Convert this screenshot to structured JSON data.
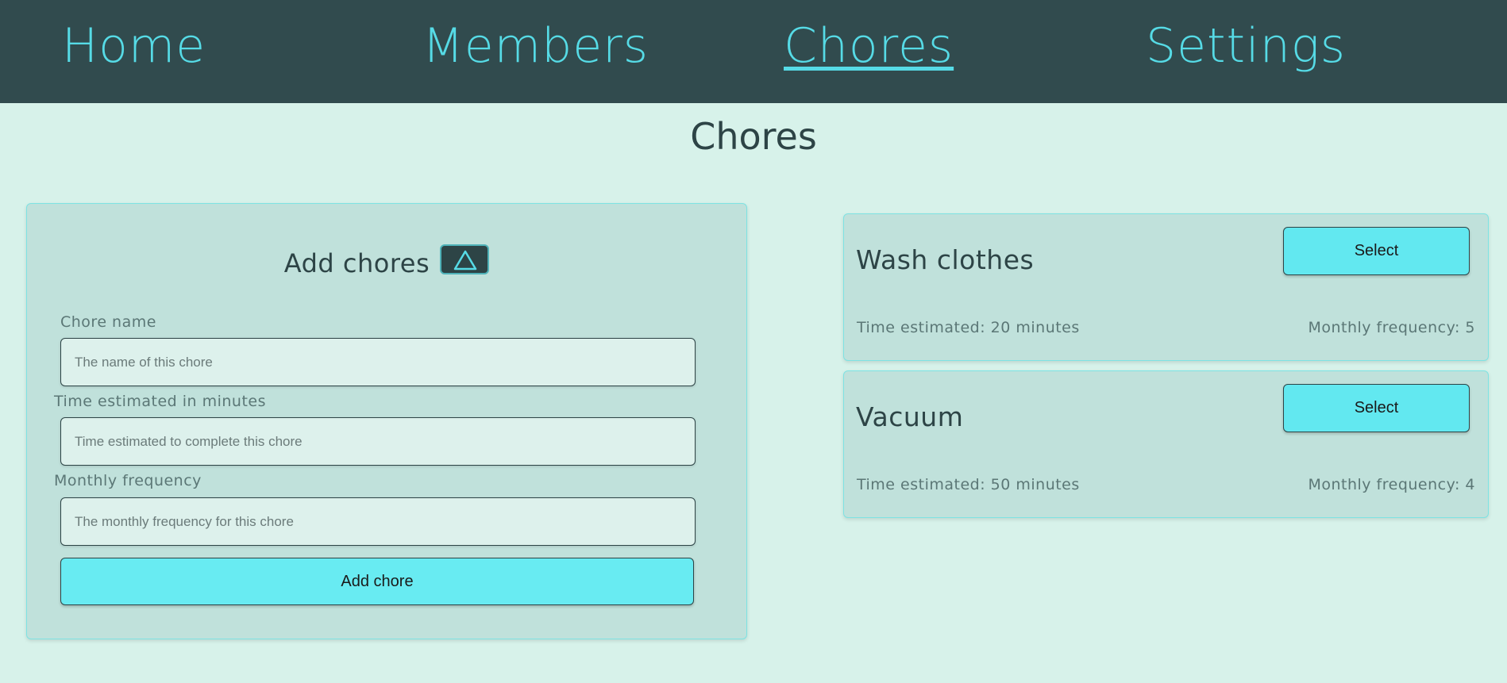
{
  "nav": {
    "items": [
      {
        "label": "Home"
      },
      {
        "label": "Members"
      },
      {
        "label": "Chores"
      },
      {
        "label": "Settings"
      }
    ],
    "active": "Chores"
  },
  "page": {
    "title": "Chores"
  },
  "add_form": {
    "title": "Add chores",
    "collapse_icon": "triangle-up-icon",
    "fields": [
      {
        "label": "Chore name",
        "placeholder": "The name of this chore",
        "value": ""
      },
      {
        "label": "Time estimated in minutes",
        "placeholder": "Time estimated to complete this chore",
        "value": ""
      },
      {
        "label": "Monthly frequency",
        "placeholder": "The monthly frequency for this chore",
        "value": ""
      }
    ],
    "submit_label": "Add chore"
  },
  "chores": [
    {
      "name": "Wash clothes",
      "select_label": "Select",
      "time_text": "Time estimated: 20 minutes",
      "frequency_text": "Monthly frequency: 5"
    },
    {
      "name": "Vacuum",
      "select_label": "Select",
      "time_text": "Time estimated: 50 minutes",
      "frequency_text": "Monthly frequency: 4"
    }
  ],
  "colors": {
    "nav_background": "#314b4e",
    "nav_link": "#56dbe6",
    "page_background": "#d7f2ea",
    "panel_background": "#c0e1db",
    "button_accent": "#68ebf2",
    "text_dark": "#2d4446"
  }
}
